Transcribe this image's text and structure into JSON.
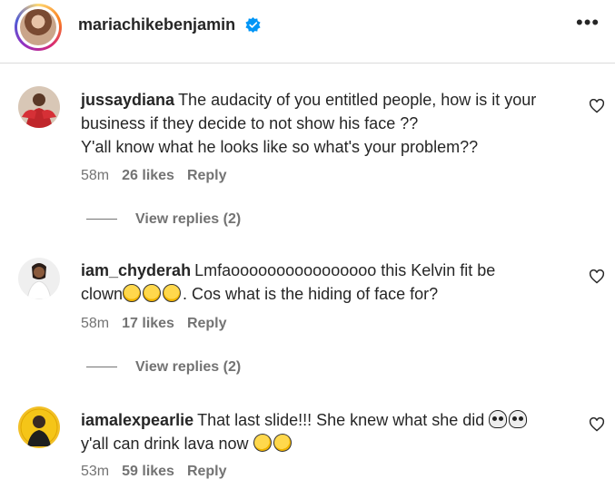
{
  "header": {
    "username": "mariachikebenjamin",
    "more_label": "•••"
  },
  "comments": [
    {
      "user": "jussaydiana",
      "lines": [
        "The audacity of you entitled people, how is it your",
        "business if they decide to not show his face ??",
        "Y'all know what he looks like so what's your problem??"
      ],
      "time": "58m",
      "likes": "26 likes",
      "reply": "Reply",
      "view_replies": "View replies (2)"
    },
    {
      "user": "iam_chyderah",
      "line1": "Lmfaoooooooooooooooo this Kelvin fit be",
      "line2_start": "clown",
      "line2_end": ". Cos what is the hiding of face for?",
      "time": "58m",
      "likes": "17 likes",
      "reply": "Reply",
      "view_replies": "View replies (2)"
    },
    {
      "user": "iamalexpearlie",
      "line1": "That last slide!!! She knew what she did",
      "line2": "y'all can drink lava now",
      "time": "53m",
      "likes": "59 likes",
      "reply": "Reply"
    }
  ],
  "colors": {
    "text": "#262626",
    "secondary": "#737373",
    "verified": "#0095f6",
    "divider": "#dbdbdb"
  }
}
